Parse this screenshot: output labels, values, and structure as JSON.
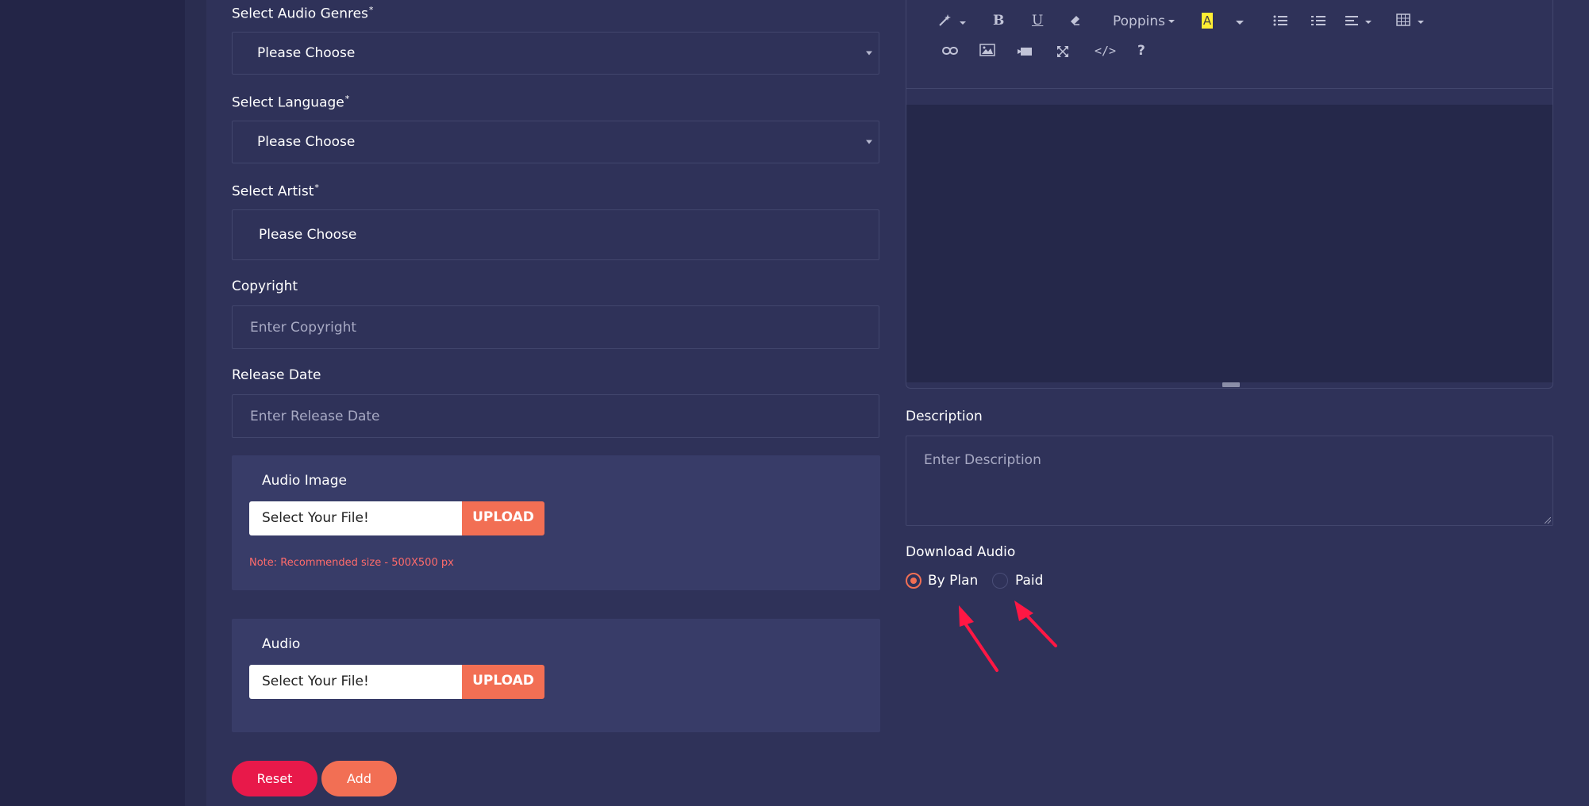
{
  "form": {
    "genres": {
      "label": "Select Audio Genres",
      "required": "*",
      "value": "Please Choose"
    },
    "language": {
      "label": "Select Language",
      "required": "*",
      "value": "Please Choose"
    },
    "artist": {
      "label": "Select Artist",
      "required": "*",
      "value": "Please Choose"
    },
    "copyright": {
      "label": "Copyright",
      "placeholder": "Enter Copyright"
    },
    "release_date": {
      "label": "Release Date",
      "placeholder": "Enter Release Date"
    },
    "audio_image": {
      "label": "Audio Image",
      "file_text": "Select Your File!",
      "upload_label": "UPLOAD",
      "note": "Note: Recommended size - 500X500 px"
    },
    "audio": {
      "label": "Audio",
      "file_text": "Select Your File!",
      "upload_label": "UPLOAD"
    },
    "reset_label": "Reset",
    "add_label": "Add"
  },
  "editor": {
    "font_name": "Poppins",
    "toolbar_icons": [
      "magic-wand-icon",
      "bold-icon",
      "underline-icon",
      "eraser-icon",
      "font-family-dropdown",
      "highlight-color-icon",
      "color-dropdown-icon",
      "unordered-list-icon",
      "ordered-list-icon",
      "align-icon",
      "table-icon",
      "link-icon",
      "image-icon",
      "video-icon",
      "fullscreen-icon",
      "code-view-icon",
      "help-icon"
    ],
    "bold_glyph": "B",
    "underline_glyph": "U",
    "highlight_glyph": "A",
    "code_glyph": "</>",
    "help_glyph": "?"
  },
  "description": {
    "label": "Description",
    "placeholder": "Enter Description"
  },
  "download_audio": {
    "label": "Download Audio",
    "options": [
      {
        "label": "By Plan",
        "selected": true
      },
      {
        "label": "Paid",
        "selected": false
      }
    ]
  },
  "colors": {
    "accent": "#f26f54",
    "reset_button": "#e8194a",
    "annotation_arrow": "#ff1744",
    "panel": "#2f3259"
  }
}
